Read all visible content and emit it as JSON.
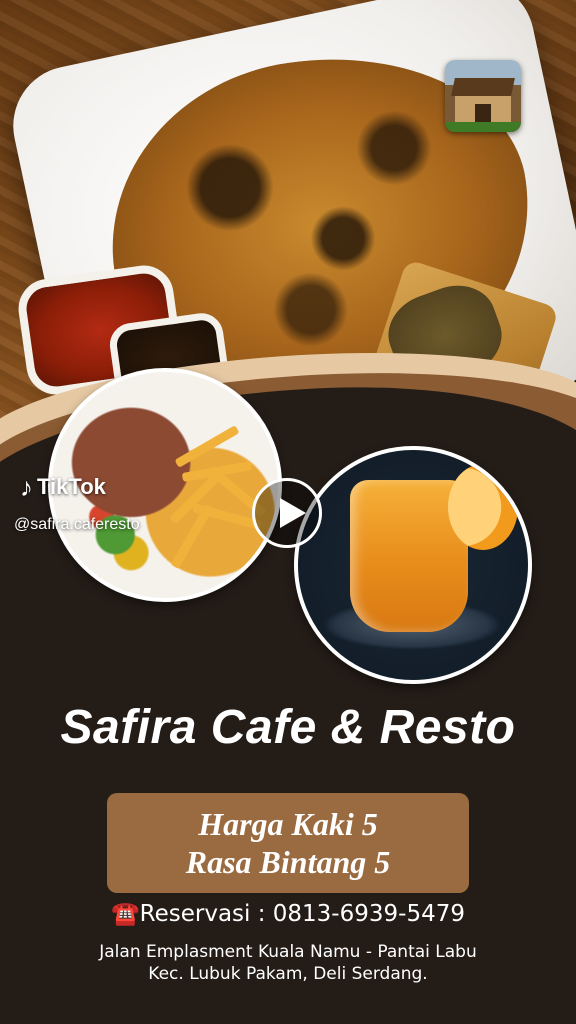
{
  "tiktok": {
    "brand": "TikTok",
    "handle": "@safira.caferesto",
    "logo_icon": "tiktok-note-icon"
  },
  "restaurant": {
    "name": "Safira Cafe & Resto"
  },
  "tagline": {
    "line1": "Harga Kaki 5",
    "line2": "Rasa Bintang 5"
  },
  "reservation": {
    "icon": "telephone-icon",
    "glyph": "☎️",
    "text": "Reservasi : 0813-6939-5479"
  },
  "address": {
    "line1": "Jalan Emplasment Kuala Namu - Pantai Labu",
    "line2": "Kec. Lubuk Pakam, Deli Serdang."
  },
  "colors": {
    "background": "#241c17",
    "accent_brown": "#9a6a40",
    "wave_light": "#e6c9a3",
    "text": "#ffffff"
  }
}
